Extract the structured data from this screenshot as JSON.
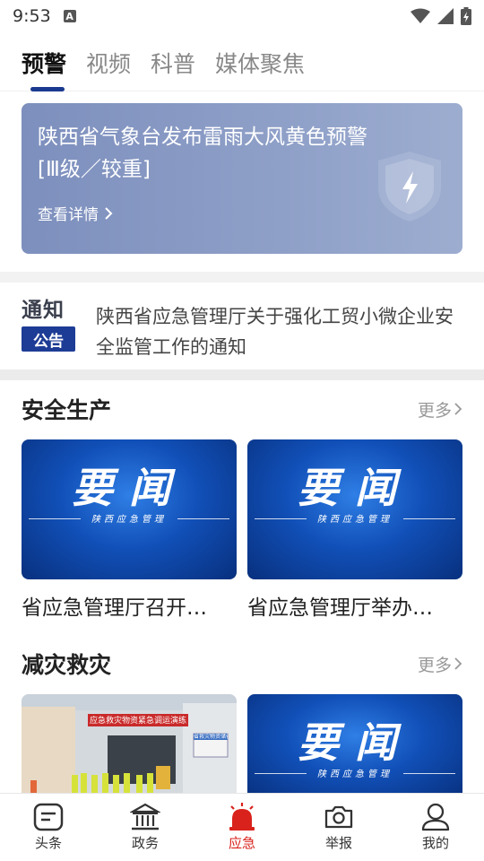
{
  "status": {
    "time": "9:53",
    "indicator": "A"
  },
  "tabs": [
    {
      "label": "预警",
      "active": true
    },
    {
      "label": "视频",
      "active": false
    },
    {
      "label": "科普",
      "active": false
    },
    {
      "label": "媒体聚焦",
      "active": false
    }
  ],
  "alert": {
    "title": "陕西省气象台发布雷雨大风黄色预警[Ⅲ级／较重]",
    "detail_label": "查看详情",
    "icon": "lightning-shield-icon"
  },
  "notice": {
    "logo_top": "通知",
    "logo_bottom": "公告",
    "text": "陕西省应急管理厅关于强化工贸小微企业安全监管工作的通知"
  },
  "sections": [
    {
      "title": "安全生产",
      "more_label": "更多",
      "cards": [
        {
          "headline": "要闻",
          "sub": "陕西应急管理",
          "caption": "省应急管理厅召开…"
        },
        {
          "headline": "要闻",
          "sub": "陕西应急管理",
          "caption": "省应急管理厅举办…"
        }
      ]
    },
    {
      "title": "减灾救灾",
      "more_label": "更多",
      "cards": [
        {
          "photo_banner": "应急救灾物资紧急调运演练",
          "photo_sign": "省救灾物资储备库"
        },
        {
          "headline": "要闻",
          "sub": "陕西应急管理"
        }
      ]
    }
  ],
  "bottom_nav": [
    {
      "label": "头条",
      "icon": "news-icon",
      "active": false
    },
    {
      "label": "政务",
      "icon": "government-building-icon",
      "active": false
    },
    {
      "label": "应急",
      "icon": "alarm-siren-icon",
      "active": true
    },
    {
      "label": "举报",
      "icon": "camera-icon",
      "active": false
    },
    {
      "label": "我的",
      "icon": "user-icon",
      "active": false
    }
  ],
  "colors": {
    "accent_blue": "#1a3a8f",
    "active_red": "#d9221c",
    "alert_bg": "#8596c2"
  }
}
